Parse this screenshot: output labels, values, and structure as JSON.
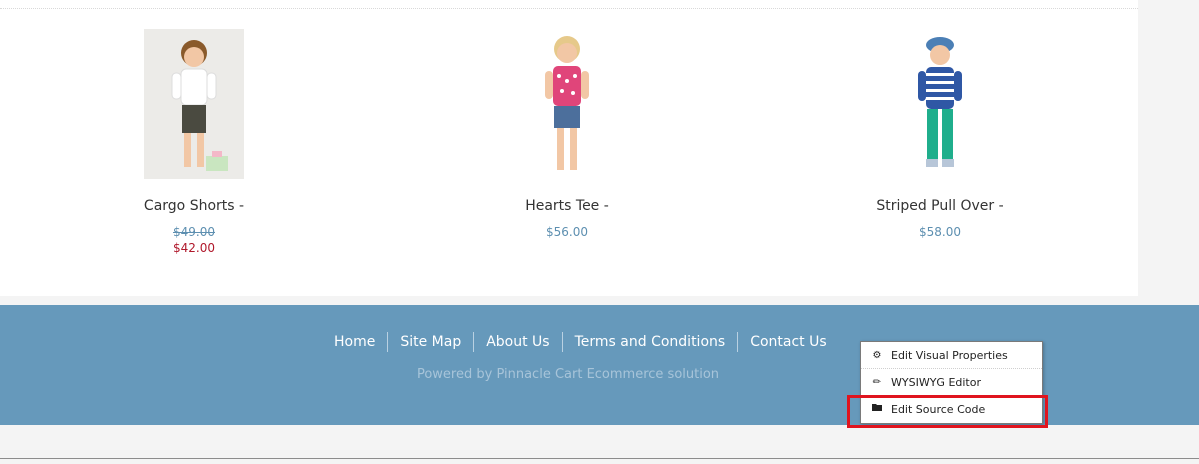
{
  "products": [
    {
      "name": "Cargo Shorts -",
      "price_old": "$49.00",
      "price_sale": "$42.00"
    },
    {
      "name": "Hearts Tee -",
      "price": "$56.00"
    },
    {
      "name": "Striped Pull Over -",
      "price": "$58.00"
    }
  ],
  "footer": {
    "nav": [
      "Home",
      "Site Map",
      "About Us",
      "Terms and Conditions",
      "Contact Us"
    ],
    "powered": "Powered by Pinnacle Cart Ecommerce solution"
  },
  "context_menu": {
    "items": [
      {
        "label": "Edit Visual Properties",
        "icon": "gear-icon"
      },
      {
        "label": "WYSIWYG Editor",
        "icon": "pencil-icon"
      },
      {
        "label": "Edit Source Code",
        "icon": "folder-icon"
      }
    ]
  },
  "colors": {
    "footer_bg": "#6699bb",
    "price": "#5d8fb0",
    "sale_price": "#b0182b",
    "highlight": "#e0141e"
  }
}
